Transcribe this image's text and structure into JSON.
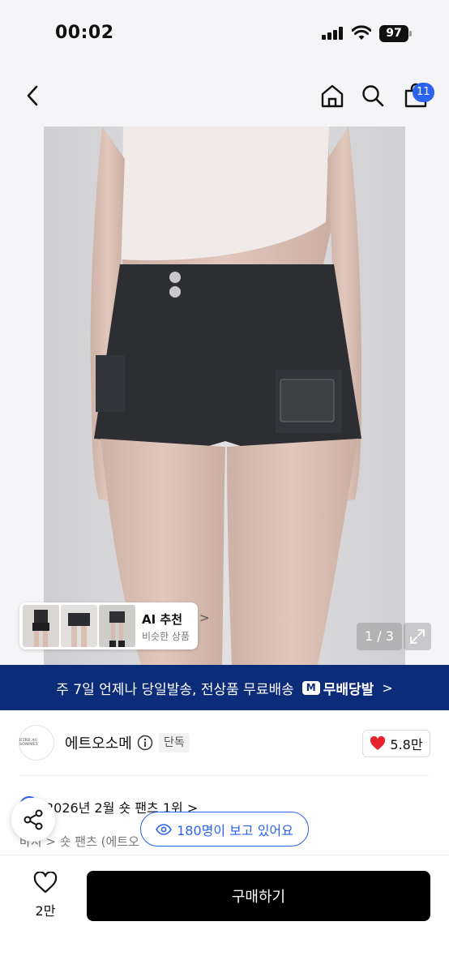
{
  "status": {
    "time": "00:02",
    "battery": "97"
  },
  "nav": {
    "cart_count": "11"
  },
  "gallery": {
    "counter": "1 / 3"
  },
  "ai_card": {
    "title": "AI 추천",
    "subtitle": "비슷한 상품",
    "chevron": ">"
  },
  "banner": {
    "text": "주 7일 언제나 당일발송, 전상품 무료배송",
    "logo_mark": "M",
    "logo_text": "무배당발",
    "chevron": ">"
  },
  "seller": {
    "logo_text": "ETRE AU SOMMET",
    "name": "에트오소메",
    "tag": "단독",
    "likes": "5.8만"
  },
  "ranking": {
    "text": "2026년 2월 숏 팬츠 1위 >"
  },
  "breadcrumb": {
    "text": "바지 > 숏 팬츠 (에트오"
  },
  "viewers": {
    "text": "180명이 보고 있어요"
  },
  "bottom": {
    "wish_count": "2만",
    "buy_label": "구매하기"
  },
  "colors": {
    "accent_blue": "#2b62f0",
    "banner_navy": "#0c2c7a",
    "heart_red": "#e8212e"
  },
  "icons": [
    "back-icon",
    "home-icon",
    "search-icon",
    "shopping-bag-icon",
    "expand-icon",
    "info-icon",
    "heart-icon",
    "share-icon",
    "eye-icon",
    "heart-outline-icon"
  ]
}
